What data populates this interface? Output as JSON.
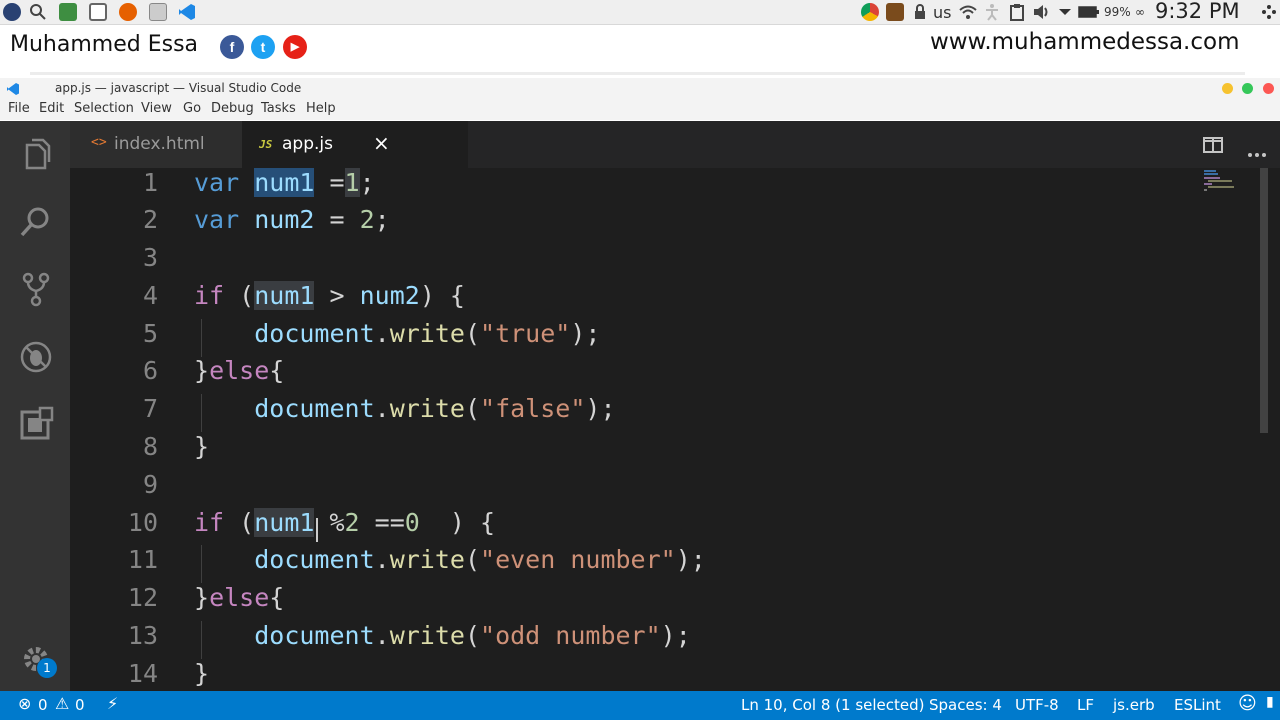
{
  "os_panel": {
    "keyboard_layout": "us",
    "battery": "99%",
    "clock": "9:32 PM"
  },
  "banner": {
    "author": "Muhammed Essa",
    "social": [
      "f",
      "t",
      "▶"
    ],
    "website": "www.muhammedessa.com"
  },
  "window": {
    "title": "app.js — javascript — Visual Studio Code"
  },
  "menu": [
    "File",
    "Edit",
    "Selection",
    "View",
    "Go",
    "Debug",
    "Tasks",
    "Help"
  ],
  "tabs": [
    {
      "icon": "<>",
      "label": "index.html"
    },
    {
      "icon": "JS",
      "label": "app.js",
      "close": "×"
    }
  ],
  "line_numbers": [
    "1",
    "2",
    "3",
    "4",
    "5",
    "6",
    "7",
    "8",
    "9",
    "10",
    "11",
    "12",
    "13",
    "14"
  ],
  "code_lines": [
    "var num1 =1;",
    "var num2 = 2;",
    "",
    "if (num1 > num2) {",
    "    document.write(\"true\");",
    "}else{",
    "    document.write(\"false\");",
    "}",
    "",
    "if (num1 %2 ==0  ) {",
    "    document.write(\"even number\");",
    "}else{",
    "    document.write(\"odd number\");",
    "}"
  ],
  "activity_badge": "1",
  "status": {
    "errors": "0",
    "warnings": "0",
    "position": "Ln 10, Col 8 (1 selected)",
    "spaces": "Spaces: 4",
    "encoding": "UTF-8",
    "eol": "LF",
    "language": "js.erb",
    "linter": "ESLint"
  },
  "colors": {
    "editor_bg": "#1e1e1e",
    "activity_bg": "#333333",
    "status_bg": "#007acc",
    "keyword": "#569cd6",
    "control": "#c586c0",
    "string": "#ce9178",
    "identifier": "#9cdcfe",
    "function": "#dcdcaa"
  }
}
